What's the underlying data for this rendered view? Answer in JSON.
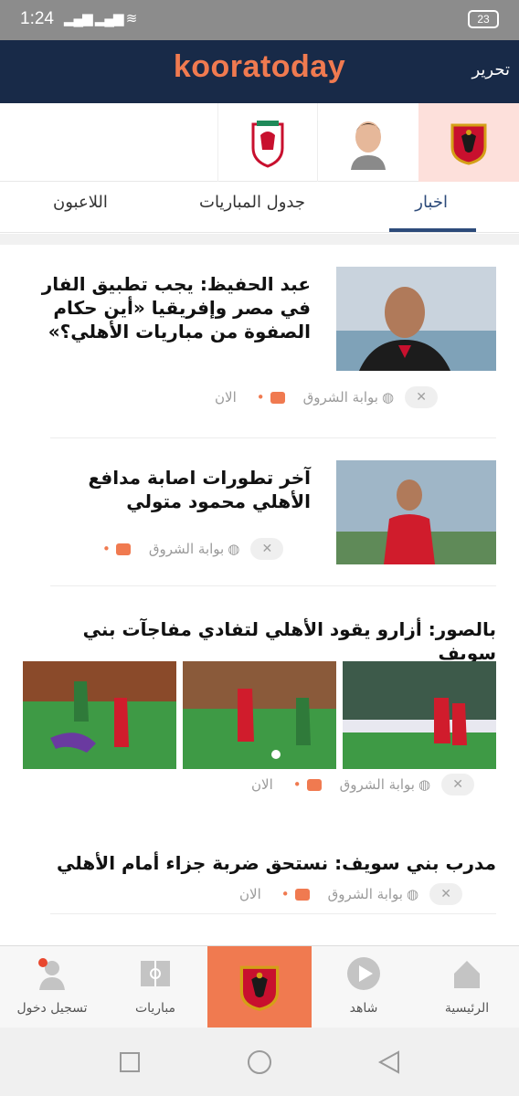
{
  "status": {
    "time": "1:24",
    "battery": "23"
  },
  "appbar": {
    "brand": "kooratoday",
    "edit": "تحرير"
  },
  "favorites": [
    {
      "name": "al-ahly-logo",
      "selected": true
    },
    {
      "name": "player-avatar",
      "selected": false
    },
    {
      "name": "liverpool-logo",
      "selected": false
    }
  ],
  "tabs": [
    {
      "label": "اخبار",
      "active": true
    },
    {
      "label": "جدول المباريات",
      "active": false
    },
    {
      "label": "اللاعبون",
      "active": false
    }
  ],
  "articles": [
    {
      "title": "عبد الحفيظ: يجب تطبيق الفار في مصر وإفريقيا «أين حكام الصفوة من مباريات الأهلي؟»",
      "source": "بوابة الشروق",
      "time": "الان"
    },
    {
      "title": "آخر تطورات اصابة مدافع الأهلي محمود متولي",
      "source": "بوابة الشروق",
      "time": ""
    },
    {
      "title": "بالصور: أزارو يقود الأهلي لتفادي مفاجآت بني سويف",
      "source": "بوابة الشروق",
      "time": "الان"
    },
    {
      "title": "مدرب بني سويف: نستحق ضربة جزاء أمام الأهلي",
      "source": "بوابة الشروق",
      "time": "الان"
    }
  ],
  "bottom_nav": [
    {
      "label": "الرئيسية",
      "icon": "home-icon"
    },
    {
      "label": "شاهد",
      "icon": "play-icon"
    },
    {
      "label": "",
      "icon": "club-logo-icon"
    },
    {
      "label": "مباريات",
      "icon": "matches-icon"
    },
    {
      "label": "تسجيل دخول",
      "icon": "login-icon"
    }
  ],
  "colors": {
    "brand": "#f07a50",
    "appbar": "#182a48",
    "accent": "#2d4b7a"
  }
}
